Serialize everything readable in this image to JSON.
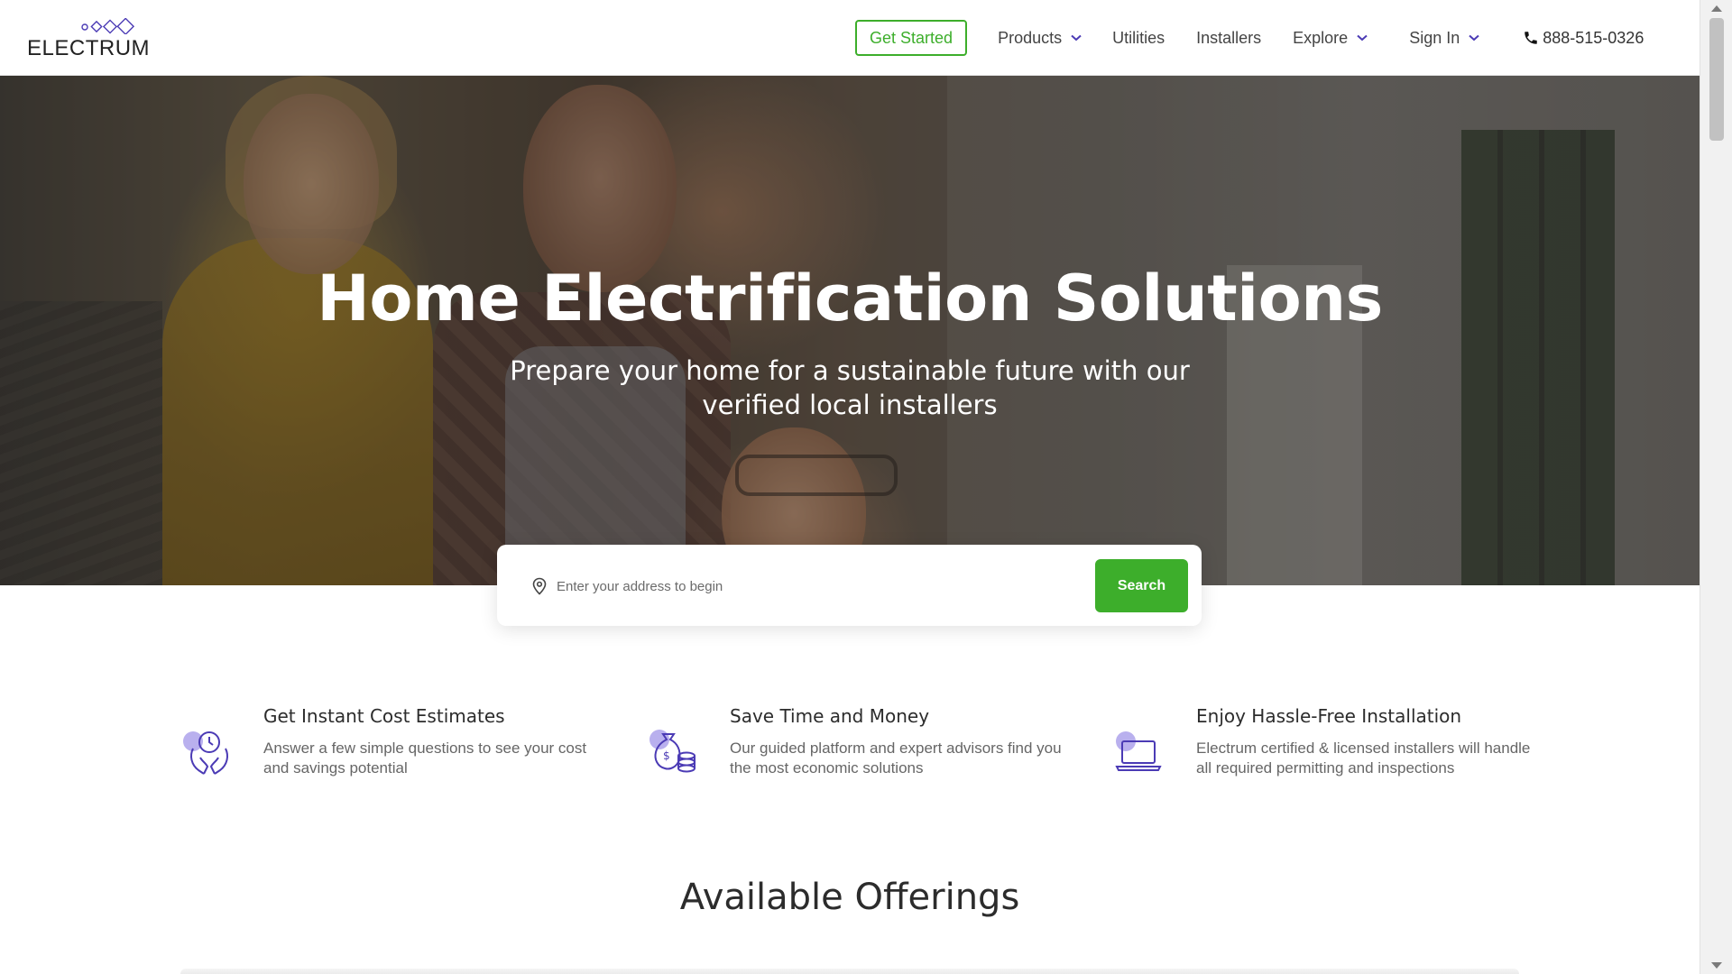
{
  "brand": {
    "name": "ELECTRUM",
    "accent_color": "#3dae2b",
    "icon_color": "#4b3bb5",
    "icon_highlight": "#b9b0ee"
  },
  "header": {
    "get_started_label": "Get Started",
    "nav": {
      "products_label": "Products",
      "utilities_label": "Utilities",
      "installers_label": "Installers",
      "explore_label": "Explore",
      "signin_label": "Sign In",
      "phone": "888-515-0326"
    }
  },
  "hero": {
    "title": "Home Electrification Solutions",
    "subtitle": "Prepare your home for a sustainable future with our verified local installers"
  },
  "search": {
    "placeholder": "Enter your address to begin",
    "value": "",
    "button_label": "Search"
  },
  "features": [
    {
      "icon": "hands-clock-icon",
      "title": "Get Instant Cost Estimates",
      "description": "Answer a few simple questions to see your cost and savings potential"
    },
    {
      "icon": "money-bag-coins-icon",
      "title": "Save Time and Money",
      "description": "Our guided platform and expert advisors find you the most economic solutions"
    },
    {
      "icon": "laptop-icon",
      "title": "Enjoy Hassle-Free Installation",
      "description": "Electrum certified & licensed installers will handle all required permitting and inspections"
    }
  ],
  "offerings": {
    "title": "Available Offerings"
  }
}
